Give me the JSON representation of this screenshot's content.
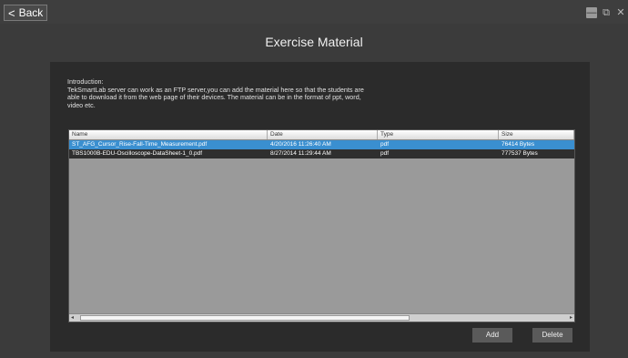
{
  "topbar": {
    "back_label": "Back",
    "min_glyph": "—",
    "restore_glyph": "⧉",
    "close_glyph": "✕"
  },
  "page": {
    "title": "Exercise Material"
  },
  "intro": {
    "heading": "Introduction:",
    "line1": "TekSmartLab server can work as an FTP server,you can add the material here so that the students are",
    "line2": "able to download it from the web page of their devices. The material can be in the format of ppt, word,",
    "line3": "video etc."
  },
  "table": {
    "headers": [
      "Name",
      "Date",
      "Type",
      "Size"
    ],
    "rows": [
      {
        "name": "ST_AFG_Cursor_Rise-Fall-Time_Measurement.pdf",
        "date": "4/20/2016 11:26:40 AM",
        "type": "pdf",
        "size": "76414 Bytes"
      },
      {
        "name": "TBS1000B-EDU-Oscilloscope-DataSheet-1_0.pdf",
        "date": "8/27/2014 11:29:44 AM",
        "type": "pdf",
        "size": "777537 Bytes"
      }
    ]
  },
  "scroll": {
    "left_arrow": "◂",
    "right_arrow": "▸"
  },
  "actions": {
    "add_label": "Add",
    "delete_label": "Delete"
  },
  "colors": {
    "selection": "#3a8fd0",
    "panel": "#2b2b2b",
    "background": "#3b3b3b"
  }
}
